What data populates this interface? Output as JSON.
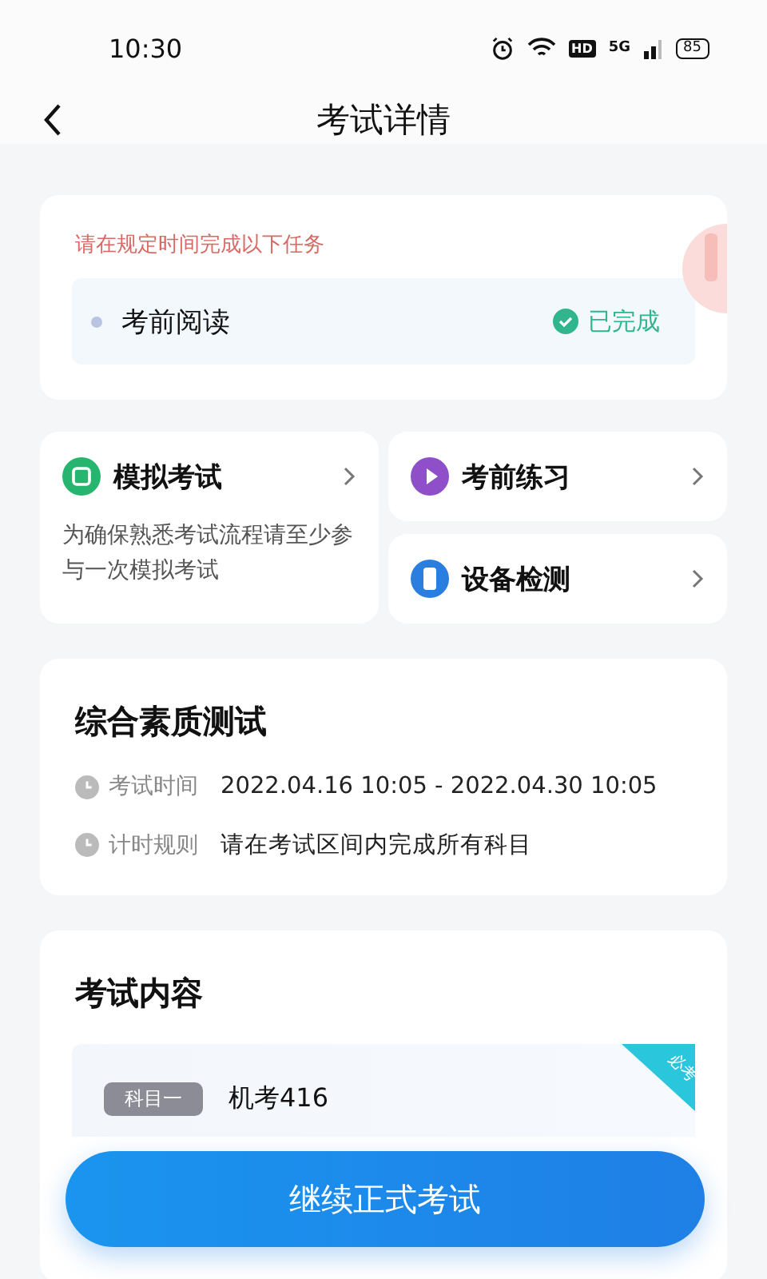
{
  "status_bar": {
    "time": "10:30",
    "network": "5G",
    "hd": "HD",
    "battery": "85"
  },
  "header": {
    "title": "考试详情"
  },
  "task_card": {
    "notice": "请在规定时间完成以下任务",
    "tasks": [
      {
        "name": "考前阅读",
        "status": "已完成",
        "done": true
      }
    ]
  },
  "shortcuts": [
    {
      "title": "模拟考试",
      "kind": "mock",
      "description": "为确保熟悉考试流程请至少参与一次模拟考试"
    },
    {
      "title": "考前练习",
      "kind": "practice"
    },
    {
      "title": "设备检测",
      "kind": "device"
    }
  ],
  "exam_info": {
    "title": "综合素质测试",
    "rows": [
      {
        "label": "考试时间",
        "value": "2022.04.16 10:05 - 2022.04.30 10:05"
      },
      {
        "label": "计时规则",
        "value": "请在考试区间内完成所有科目"
      }
    ]
  },
  "exam_content": {
    "title": "考试内容",
    "subjects": [
      {
        "tag": "科目一",
        "name": "机考416",
        "ribbon": "必考"
      }
    ]
  },
  "primary_button": "继续正式考试"
}
